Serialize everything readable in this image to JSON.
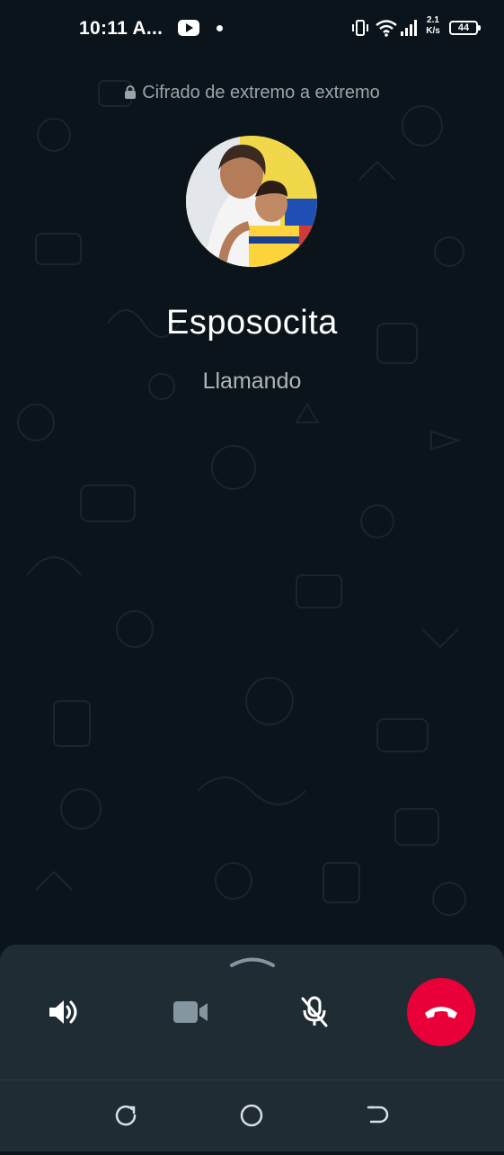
{
  "status_bar": {
    "time": "10:11 A...",
    "net_speed_value": "2.1",
    "net_speed_unit": "K/s",
    "battery_level": "44",
    "icons": [
      "youtube-icon",
      "notification-dot",
      "vibrate-icon",
      "wifi-icon",
      "signal-icon",
      "battery-icon"
    ]
  },
  "call": {
    "encryption_text": "Cifrado de extremo a extremo",
    "contact_name": "Esposocita",
    "status": "Llamando"
  },
  "controls": {
    "items": [
      "speaker-icon",
      "video-icon",
      "mute-icon",
      "end-call-icon"
    ],
    "end_call_color": "#ea0038",
    "panel_color": "#1f2c34"
  },
  "nav": {
    "items": [
      "recents-icon",
      "home-icon",
      "back-icon"
    ]
  },
  "colors": {
    "background": "#0b141a",
    "text_primary": "#ffffff",
    "text_secondary": "#aeb6ba"
  }
}
